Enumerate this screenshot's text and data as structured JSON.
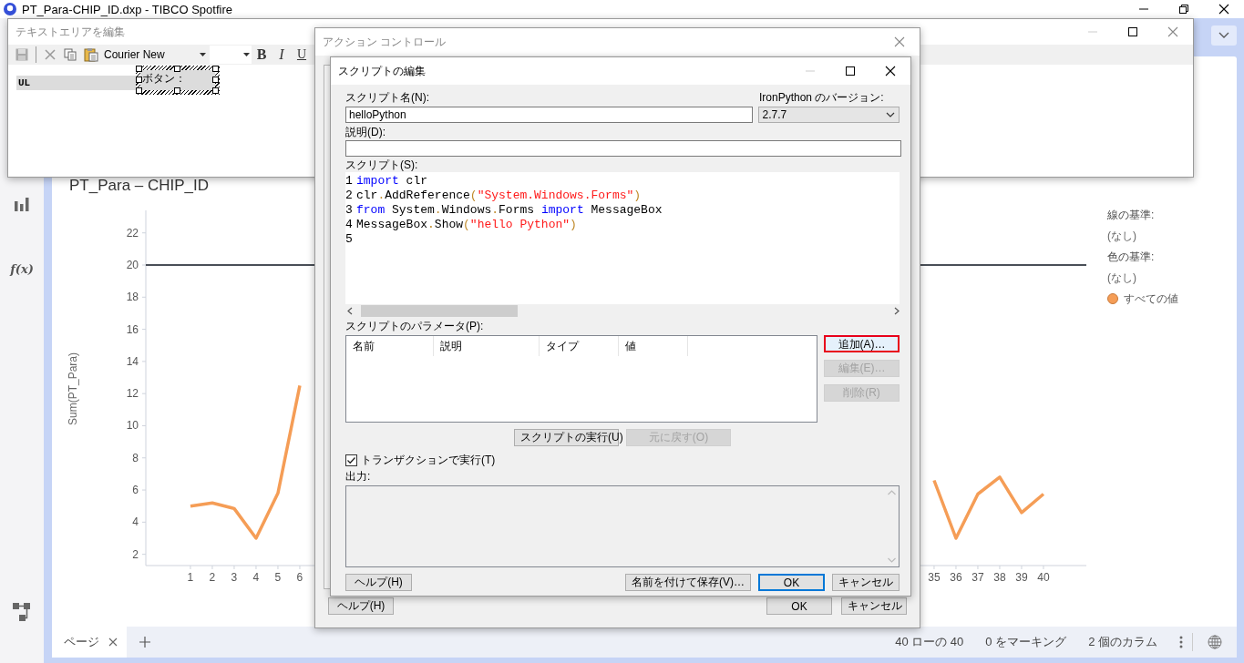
{
  "app": {
    "title": "PT_Para-CHIP_ID.dxp - TIBCO Spotfire"
  },
  "sidebar": {
    "function_label": "f(x)"
  },
  "visualization": {
    "chart_data": {
      "type": "line",
      "title": "PT_Para – CHIP_ID",
      "ylabel": "Sum(PT_Para)",
      "x": [
        1,
        2,
        3,
        4,
        5,
        6,
        7,
        8,
        9,
        10,
        11,
        12,
        13,
        14,
        15,
        16,
        17,
        18,
        19,
        20,
        21,
        22,
        23,
        24,
        25,
        26,
        27,
        28,
        29,
        30,
        31,
        32,
        33,
        34,
        35,
        36,
        37,
        38,
        39,
        40
      ],
      "series": [
        {
          "name": "すべての値",
          "color": "#f59d56",
          "values": [
            5.0,
            5.2,
            4.85,
            3.0,
            5.8,
            12.5,
            null,
            null,
            null,
            null,
            null,
            null,
            null,
            null,
            null,
            null,
            null,
            null,
            null,
            null,
            null,
            null,
            null,
            null,
            null,
            null,
            null,
            null,
            null,
            null,
            null,
            null,
            null,
            null,
            6.6,
            3.0,
            5.75,
            6.8,
            4.6,
            5.75
          ]
        }
      ],
      "xlim": [
        -1.04,
        41.96
      ],
      "ylim": [
        1.3,
        23.4
      ],
      "yticks": [
        2,
        4,
        6,
        8,
        10,
        12,
        14,
        16,
        18,
        20,
        22
      ],
      "xticks": [
        1,
        2,
        3,
        4,
        5,
        6,
        35,
        36,
        37,
        38,
        39,
        40
      ],
      "ref_lines": [
        {
          "axis": "y",
          "value": 20
        }
      ]
    },
    "legend": [
      {
        "kind": "heading",
        "text": "線の基準:"
      },
      {
        "kind": "value",
        "text": "(なし)"
      },
      {
        "kind": "heading",
        "text": "色の基準:"
      },
      {
        "kind": "value",
        "text": "(なし)"
      }
    ]
  },
  "page_tabs": [
    {
      "label": "ページ",
      "selected": true
    }
  ],
  "status_bar": [
    "40 ローの 40",
    "0 をマーキング",
    "2 個のカラム"
  ],
  "text_area_editor": {
    "title": "テキストエリアを編集",
    "font": "Courier New",
    "format_buttons": [
      {
        "label": "B",
        "kind": "bold"
      },
      {
        "label": "I",
        "kind": "italic"
      },
      {
        "label": "U",
        "kind": "underline"
      }
    ],
    "content_line": "UL",
    "button_label": "ボタン："
  },
  "action_control": {
    "title": "アクション コントロール",
    "buttons": [
      {
        "label": "ヘルプ(H)"
      },
      {
        "label": "OK"
      },
      {
        "label": "キャンセル"
      }
    ]
  },
  "script_editor": {
    "title": "スクリプトの編集",
    "name_label": "スクリプト名(N):",
    "name_value": "helloPython",
    "version_label": "IronPython のバージョン:",
    "version_value": "2.7.7",
    "description_label": "説明(D):",
    "script_label": "スクリプト(S):",
    "code_lines": [
      {
        "number": "1",
        "tokens": [
          {
            "t": "import",
            "kind": "keyword"
          },
          {
            "t": " clr",
            "kind": "plain"
          }
        ]
      },
      {
        "number": "2",
        "tokens": [
          {
            "t": "clr",
            "kind": "plain"
          },
          {
            "t": ".",
            "kind": "op"
          },
          {
            "t": "AddReference",
            "kind": "plain"
          },
          {
            "t": "(",
            "kind": "op"
          },
          {
            "t": "\"System.Windows.Forms\"",
            "kind": "string"
          },
          {
            "t": ")",
            "kind": "op"
          }
        ]
      },
      {
        "number": "3",
        "tokens": [
          {
            "t": "from",
            "kind": "keyword"
          },
          {
            "t": " System",
            "kind": "plain"
          },
          {
            "t": ".",
            "kind": "op"
          },
          {
            "t": "Windows",
            "kind": "plain"
          },
          {
            "t": ".",
            "kind": "op"
          },
          {
            "t": "Forms ",
            "kind": "plain"
          },
          {
            "t": "import",
            "kind": "keyword"
          },
          {
            "t": " MessageBox",
            "kind": "plain"
          }
        ]
      },
      {
        "number": "4",
        "tokens": [
          {
            "t": "MessageBox",
            "kind": "plain"
          },
          {
            "t": ".",
            "kind": "op"
          },
          {
            "t": "Show",
            "kind": "plain"
          },
          {
            "t": "(",
            "kind": "op"
          },
          {
            "t": "\"hello Python\"",
            "kind": "string"
          },
          {
            "t": ")",
            "kind": "op"
          }
        ]
      },
      {
        "number": "5"
      }
    ],
    "parameters_label": "スクリプトのパラメータ(P):",
    "parameter_columns": [
      "名前",
      "説明",
      "タイプ",
      "値"
    ],
    "side_buttons": [
      {
        "label": "追加(A)…",
        "disabled": false,
        "highlighted": true
      },
      {
        "label": "編集(E)…",
        "disabled": true,
        "highlighted": false
      },
      {
        "label": "削除(R)",
        "disabled": true,
        "highlighted": false
      }
    ],
    "run_buttons": [
      {
        "label": "スクリプトの実行(U)",
        "disabled": false
      },
      {
        "label": "元に戻す(O)",
        "disabled": true
      }
    ],
    "transaction": {
      "label": "トランザクションで実行(T)",
      "checked": true
    },
    "output_label": "出力:",
    "footer_buttons": [
      {
        "label": "ヘルプ(H)",
        "default": false
      },
      {
        "label": "名前を付けて保存(V)…",
        "default": false
      },
      {
        "label": "OK",
        "default": true
      },
      {
        "label": "キャンセル",
        "default": false
      }
    ]
  }
}
